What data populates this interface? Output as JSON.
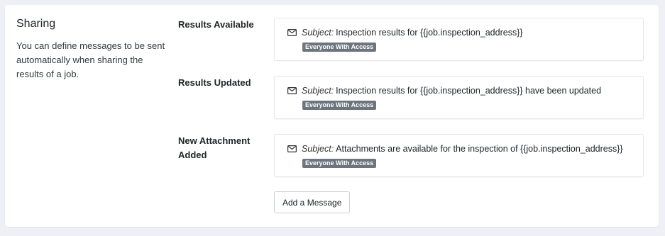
{
  "section": {
    "title": "Sharing",
    "description": "You can define messages to be sent automatically when sharing the results of a job."
  },
  "rows": [
    {
      "label": "Results Available",
      "subject_label": "Subject:",
      "subject": "Inspection results for {{job.inspection_address}}",
      "recipient": "Everyone With Access",
      "icon": "envelope-icon"
    },
    {
      "label": "Results Updated",
      "subject_label": "Subject:",
      "subject": "Inspection results for {{job.inspection_address}} have been updated",
      "recipient": "Everyone With Access",
      "icon": "envelope-icon"
    },
    {
      "label": "New Attachment Added",
      "subject_label": "Subject:",
      "subject": "Attachments are available for the inspection of {{job.inspection_address}}",
      "recipient": "Everyone With Access",
      "icon": "envelope-icon"
    }
  ],
  "actions": {
    "add_message_label": "Add a Message"
  },
  "colors": {
    "page_background": "#eef0f5",
    "card_background": "#ffffff",
    "badge_background": "#6c757d"
  }
}
